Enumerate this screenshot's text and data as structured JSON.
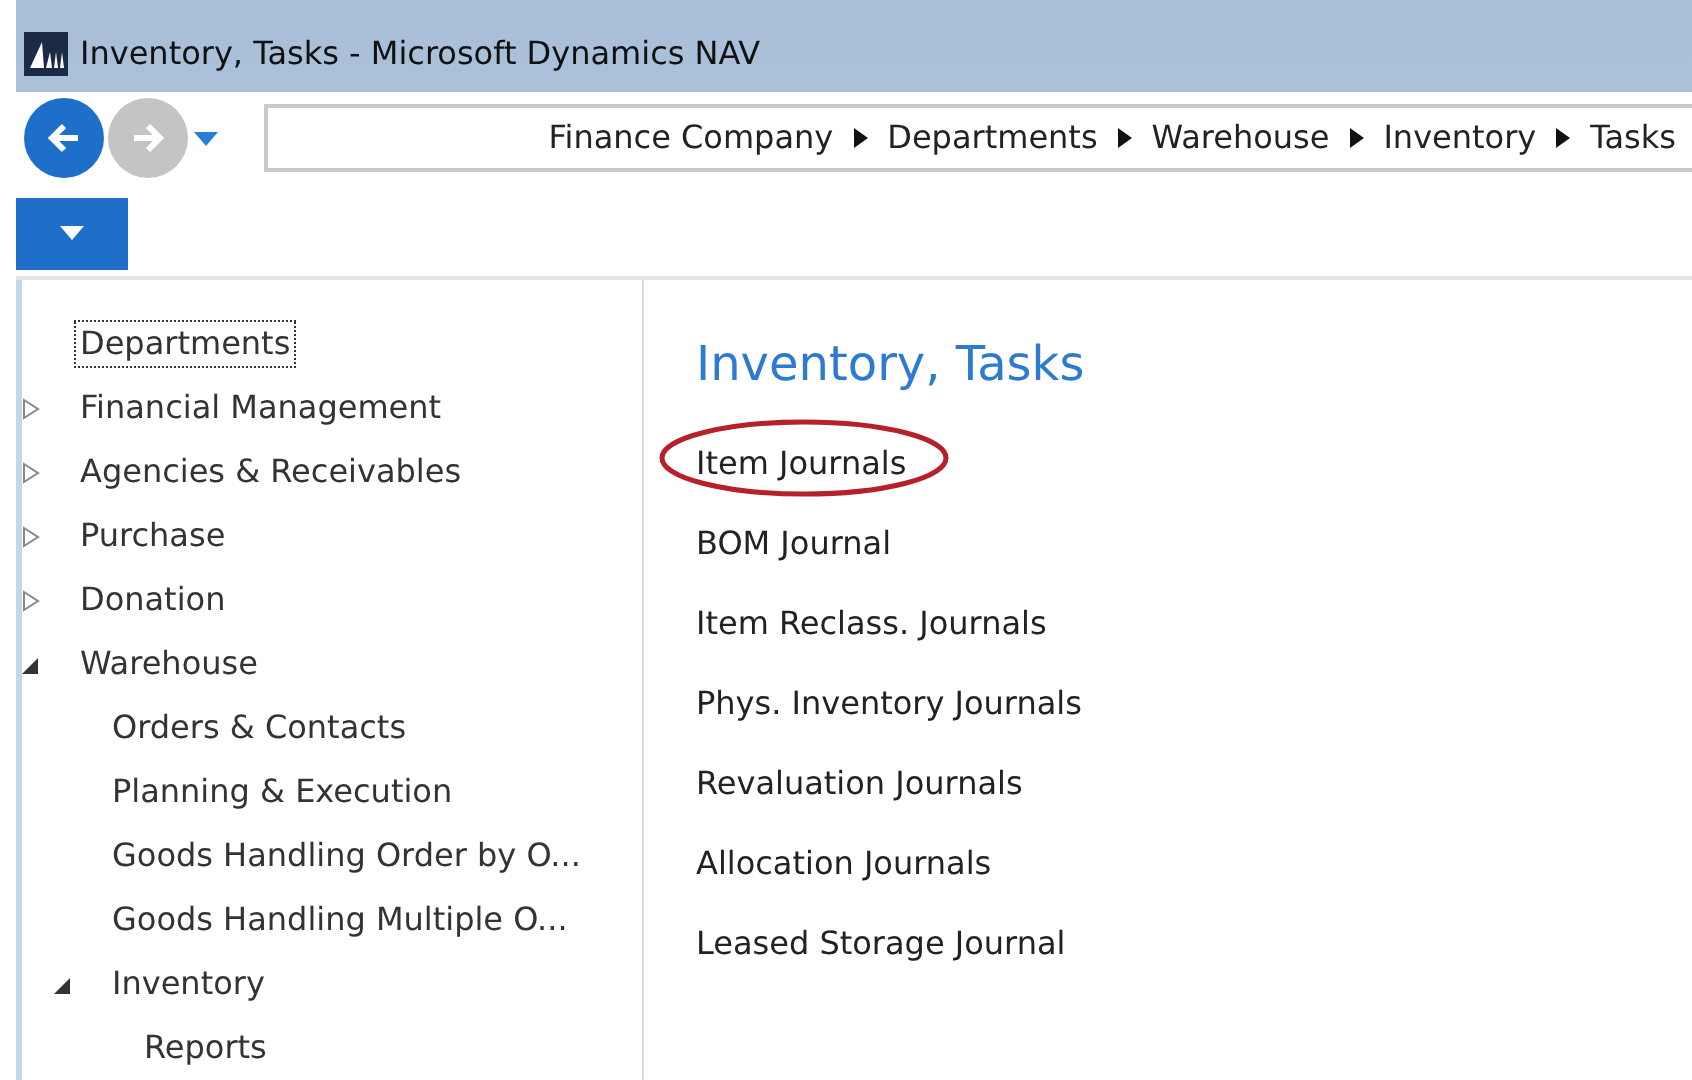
{
  "window": {
    "title": "Inventory, Tasks - Microsoft Dynamics NAV"
  },
  "navigation": {
    "back_enabled": true,
    "forward_enabled": false
  },
  "breadcrumb": [
    "Finance Company",
    "Departments",
    "Warehouse",
    "Inventory",
    "Tasks"
  ],
  "sidebar": {
    "tree": [
      {
        "label": "Departments",
        "kind": "root",
        "focused": true,
        "children": [
          {
            "label": "Financial Management",
            "kind": "folder",
            "expanded": false,
            "focused": false
          },
          {
            "label": "Agencies & Receivables",
            "kind": "folder",
            "expanded": false,
            "focused": false
          },
          {
            "label": "Purchase",
            "kind": "folder",
            "expanded": false,
            "focused": false
          },
          {
            "label": "Donation",
            "kind": "folder",
            "expanded": false,
            "focused": false
          },
          {
            "label": "Warehouse",
            "kind": "folder",
            "expanded": true,
            "focused": false,
            "children": [
              {
                "label": "Orders & Contacts",
                "kind": "leaf",
                "focused": false
              },
              {
                "label": "Planning & Execution",
                "kind": "leaf",
                "focused": false
              },
              {
                "label": "Goods Handling Order by O...",
                "kind": "leaf",
                "focused": false
              },
              {
                "label": "Goods Handling Multiple O...",
                "kind": "leaf",
                "focused": false
              },
              {
                "label": "Inventory",
                "kind": "folder",
                "expanded": true,
                "focused": false,
                "children": [
                  {
                    "label": "Reports",
                    "kind": "leaf",
                    "focused": false
                  }
                ]
              }
            ]
          }
        ]
      }
    ]
  },
  "content": {
    "title": "Inventory, Tasks",
    "tasks": [
      {
        "label": "Item Journals",
        "highlighted": true
      },
      {
        "label": "BOM Journal",
        "highlighted": false
      },
      {
        "label": "Item Reclass. Journals",
        "highlighted": false
      },
      {
        "label": "Phys. Inventory Journals",
        "highlighted": false
      },
      {
        "label": "Revaluation Journals",
        "highlighted": false
      },
      {
        "label": "Allocation Journals",
        "highlighted": false
      },
      {
        "label": "Leased Storage Journal",
        "highlighted": false
      }
    ]
  }
}
